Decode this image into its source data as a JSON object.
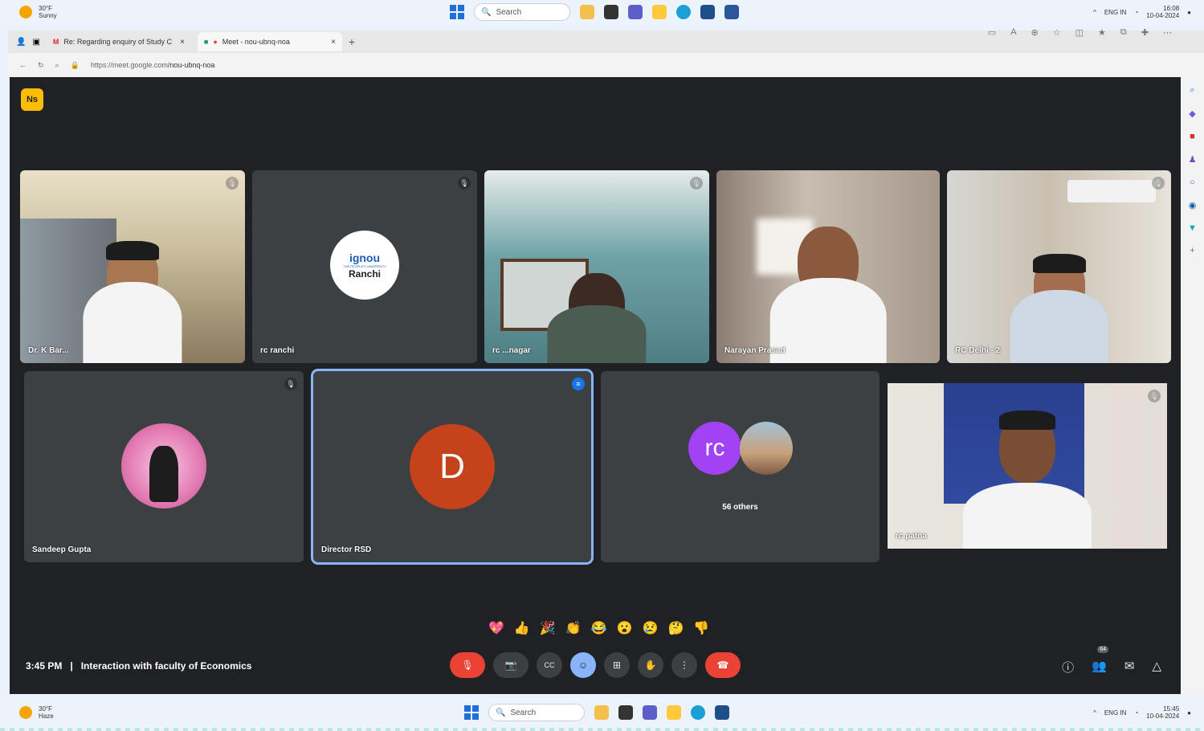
{
  "taskbar_top": {
    "weather_temp": "30°F",
    "weather_desc": "Sunny",
    "search_label": "Search",
    "date": "10-04-2024",
    "time": "16:08",
    "lang": "ENG IN"
  },
  "browser": {
    "tabs": [
      {
        "label": "Re: Regarding enquiry of Study C",
        "close": "×"
      },
      {
        "label": "Meet - nou-ubnq-noa",
        "close": "×"
      }
    ],
    "new_tab": "+",
    "url_host": "https://meet.google.com",
    "url_path": "/nou-ubnq-noa"
  },
  "meet": {
    "logo_text": "Ns",
    "participants_row1": [
      {
        "name": "Dr. K Bar..."
      },
      {
        "name": "rc ranchi",
        "logo_title": "ignou",
        "logo_sub": "THE PEOPLE'S UNIVERSITY",
        "logo_city": "Ranchi"
      },
      {
        "name": "rc ...nagar"
      },
      {
        "name": "Narayan Prasad"
      },
      {
        "name": "RC Delhi - 2"
      }
    ],
    "participants_row2": [
      {
        "name": "Sandeep Gupta"
      },
      {
        "name": "Director RSD",
        "initial": "D"
      },
      {
        "name": "",
        "initials": "rc",
        "others": "56 others"
      },
      {
        "name": "rc patna"
      }
    ],
    "time": "3:45 PM",
    "separator": "|",
    "meeting_title": "Interaction with faculty of Economics",
    "emojis": [
      "💖",
      "👍",
      "🎉",
      "👏",
      "😂",
      "😮",
      "😢",
      "🤔",
      "👎"
    ],
    "participant_count": "64",
    "controls": {
      "mic": "🎙",
      "cam": "📷",
      "cc": "CC",
      "emoji": "☺",
      "present": "⊞",
      "hand": "✋",
      "more": "⋮",
      "end": "☎"
    }
  },
  "taskbar_bottom": {
    "weather_temp": "30°F",
    "weather_desc": "Haze",
    "search_label": "Search",
    "date": "10-04-2024",
    "time": "15:45",
    "lang": "ENG IN"
  },
  "colors": {
    "meet_bg": "#202124",
    "tile_bg": "#3c4043",
    "end_call": "#ea4335",
    "highlight": "#8ab4f8"
  }
}
